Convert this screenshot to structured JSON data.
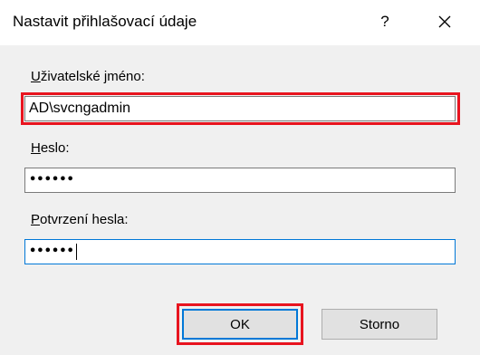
{
  "dialog": {
    "title": "Nastavit přihlašovací údaje",
    "help_label": "?",
    "close_icon": "close-x-icon"
  },
  "form": {
    "username": {
      "label_access_key": "U",
      "label_rest": "živatelské jméno:",
      "value": "AD\\svcngadmin"
    },
    "password": {
      "label_access_key": "H",
      "label_rest": "eslo:",
      "masked_value": "••••••"
    },
    "confirm_password": {
      "label_access_key": "P",
      "label_rest": "otvrzení hesla:",
      "masked_value": "••••••"
    }
  },
  "buttons": {
    "ok_label": "OK",
    "cancel_label": "Storno"
  },
  "colors": {
    "highlight_red": "#e8141f",
    "focus_blue": "#0078d7",
    "dialog_bg": "#f0f0f0"
  }
}
